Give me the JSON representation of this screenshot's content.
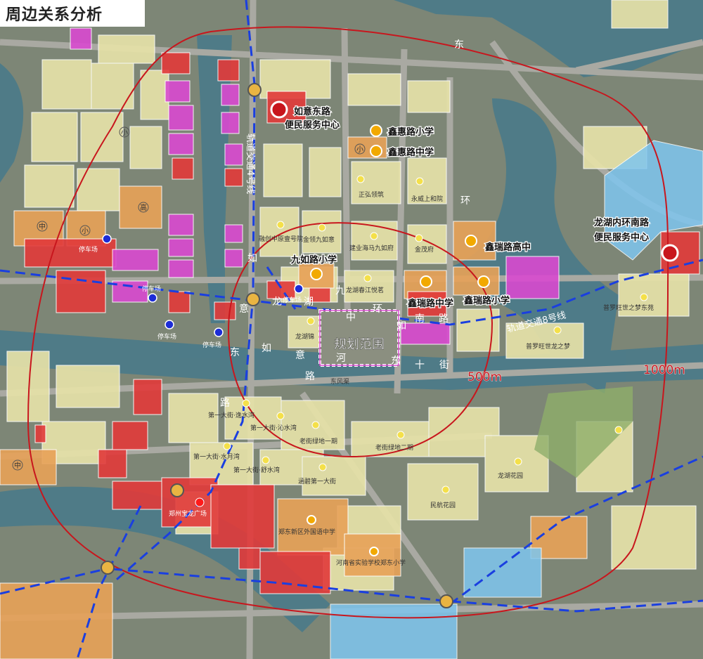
{
  "title": "周边关系分析",
  "colors": {
    "residential": "#e6e2a8",
    "school": "#e8a258",
    "commercial": "#e23a3a",
    "public": "#d94ad0",
    "hospital": "#7fc6ef",
    "green": "#8fae6a",
    "ring": "#c8161d",
    "metro": "#1a3fe0",
    "site": "#ffffff"
  },
  "rings": {
    "inner_label": "500m",
    "outer_label": "1000m"
  },
  "site_label": "规划范围",
  "metro_labels": {
    "line4": "轨道交通4号线",
    "line8": "轨道交通8号线"
  },
  "service_centers": [
    {
      "label_line1": "如意东路",
      "label_line2": "便民服务中心"
    },
    {
      "label_line1": "龙湖内环南路",
      "label_line2": "便民服务中心"
    }
  ],
  "schools": [
    {
      "label": "鑫惠路小学"
    },
    {
      "label": "鑫惠路中学"
    },
    {
      "label": "九如路小学"
    },
    {
      "label": "鑫瑞路高中"
    },
    {
      "label": "鑫瑞路中学"
    },
    {
      "label": "鑫瑞路小学"
    }
  ],
  "road_chars": {
    "n1": "东",
    "n2": "环",
    "ring_chars": [
      "如",
      "意",
      "龙",
      "湖",
      "九",
      "中",
      "环",
      "如",
      "南",
      "路"
    ],
    "east_chars": [
      "如",
      "意",
      "河",
      "东",
      "十",
      "街"
    ],
    "dong_lu": [
      "东",
      "路",
      "路"
    ]
  },
  "small_labels": [
    "正弘领筑",
    "永威上和院",
    "融创中原壹号院",
    "金领九如意",
    "建业海马九如府",
    "金茂府",
    "龙湖春江悦茗",
    "龙湖锦",
    "普罗旺世之梦东苑",
    "普罗旺世龙之梦",
    "东风渠",
    "第一大街·逸水湾",
    "第一大街·沁水湾",
    "老街绿地一期",
    "老街绿地二期",
    "第一大街·水月湾",
    "第一大街·舒水湾",
    "涵碧第一大街",
    "龙湖花园",
    "民航花园",
    "郑州宝龙广场",
    "郑东新区外国语中学",
    "河南省实验学校郑东小学",
    "停车场",
    "停车场",
    "停车场",
    "停车场",
    "停车场"
  ],
  "badges": [
    "小",
    "中",
    "小",
    "中",
    "小",
    "高"
  ]
}
